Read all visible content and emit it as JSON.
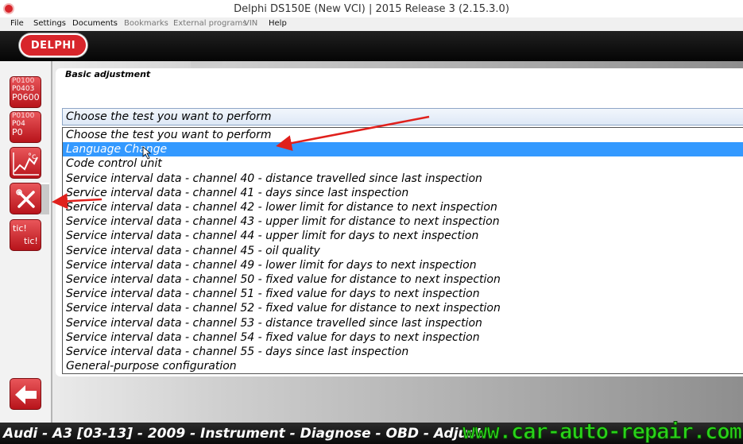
{
  "window": {
    "title": "Delphi DS150E (New VCI) | 2015 Release 3 (2.15.3.0)",
    "icon": "delphi-app-icon"
  },
  "menu": {
    "file": "File",
    "settings": "Settings",
    "documents": "Documents",
    "bookmarks": "Bookmarks",
    "external_programs": "External programs",
    "vin": "VIN",
    "help": "Help"
  },
  "brand": {
    "logo_text": "DELPHI",
    "color": "#d8252b"
  },
  "sidebar": {
    "btn1": {
      "lines": [
        "P0100",
        "P0403",
        "P0600"
      ],
      "icon": "read-fault-codes-icon"
    },
    "btn2": {
      "lines": [
        "P0100",
        "P04",
        "P0"
      ],
      "icon": "erase-fault-codes-icon"
    },
    "btn3": {
      "label": "°c",
      "icon": "live-data-graph-icon"
    },
    "btn4": {
      "icon": "tools-adjust-icon"
    },
    "btn5": {
      "line1": "tic!",
      "line2": "tic!",
      "icon": "activation-test-icon"
    }
  },
  "panel": {
    "tab_title": "Basic adjustment"
  },
  "test_select": {
    "value": "Choose the test you want to perform",
    "options": [
      "Choose the test you want to perform",
      "Language Change",
      "Code control unit",
      "Service interval data - channel 40 - distance travelled since last inspection",
      "Service interval data - channel 41 - days since last inspection",
      "Service interval data - channel 42 - lower limit for distance to next inspection",
      "Service interval data - channel 43 - upper limit for distance to next inspection",
      "Service interval data - channel 44 - upper limit for days to next inspection",
      "Service interval data - channel 45 - oil quality",
      "Service interval data - channel 49 - lower limit for days to next inspection",
      "Service interval data - channel 50 - fixed value for distance to next inspection",
      "Service interval data - channel 51 - fixed value for days to next inspection",
      "Service interval data - channel 52 - fixed value for distance to next inspection",
      "Service interval data - channel 53 - distance travelled since last inspection",
      "Service interval data - channel 54 - fixed value for days to next inspection",
      "Service interval data - channel 55 - days since last inspection",
      "General-purpose configuration"
    ],
    "selected_index": 1,
    "highlight_color": "#3399ff"
  },
  "status": {
    "text": "Audi - A3 [03-13] - 2009 - Instrument - Diagnose - OBD - Adjust"
  },
  "watermark": {
    "text": "www.car-auto-repair.com",
    "color": "#2ad21a"
  },
  "back_button": {
    "icon": "back-arrow-icon"
  },
  "annotation": {
    "arrow_color": "#e0201c"
  }
}
